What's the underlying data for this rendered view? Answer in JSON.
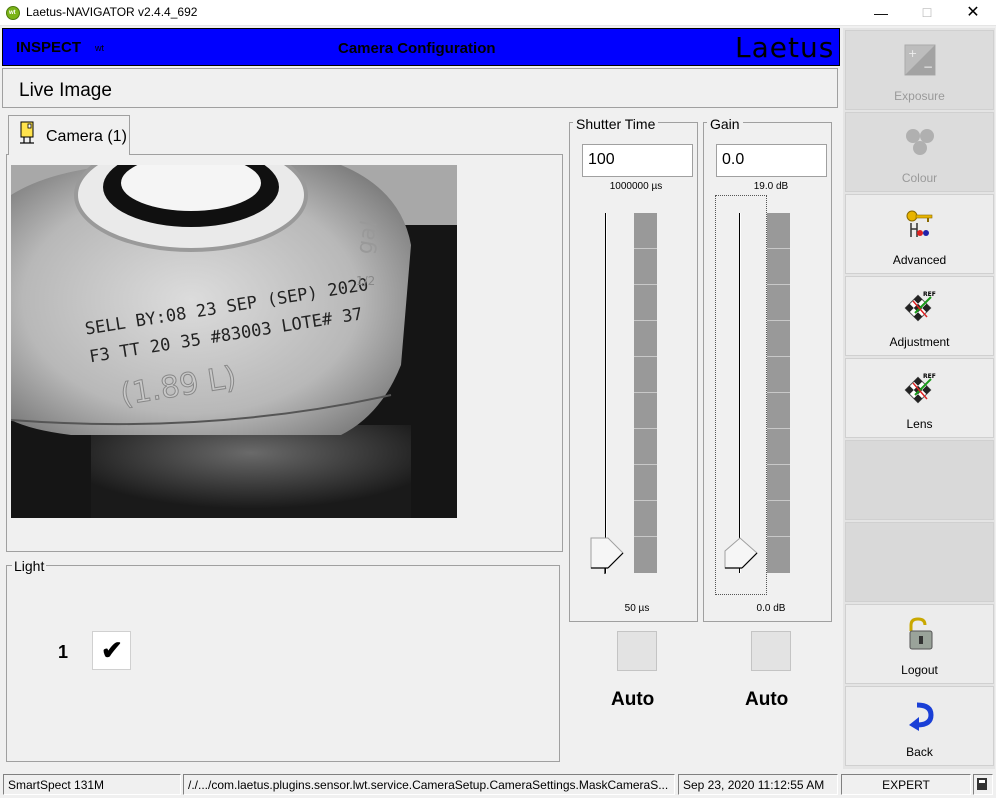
{
  "window": {
    "app_icon_text": "wt",
    "title": "Laetus-NAVIGATOR v2.4.4_692",
    "minimize": "—",
    "maximize": "☐",
    "close": "✕"
  },
  "header": {
    "inspect": "INSPECT",
    "inspect_sub": "wt",
    "title": "Camera Configuration",
    "brand": "Laetus",
    "background_color": "#0000ff"
  },
  "live_image": {
    "label": "Live Image"
  },
  "camera_tab": {
    "label": "Camera (1)"
  },
  "light": {
    "legend": "Light",
    "index": "1",
    "check_mark": "✔",
    "checked": true
  },
  "shutter": {
    "legend": "Shutter Time",
    "value": "100",
    "max_label": "1000000 µs",
    "min_label": "50 µs",
    "auto_label": "Auto",
    "slider_fraction": 0.0
  },
  "gain": {
    "legend": "Gain",
    "value": "0.0",
    "max_label": "19.0 dB",
    "min_label": "0.0 dB",
    "auto_label": "Auto",
    "slider_fraction": 0.0
  },
  "sidebar": {
    "items": [
      {
        "label": "Exposure",
        "icon": "exposure-icon",
        "enabled": false
      },
      {
        "label": "Colour",
        "icon": "colour-icon",
        "enabled": false
      },
      {
        "label": "Advanced",
        "icon": "key-icon",
        "enabled": true
      },
      {
        "label": "Adjustment",
        "icon": "adjustment-icon",
        "enabled": true
      },
      {
        "label": "Lens",
        "icon": "lens-icon",
        "enabled": true
      },
      {
        "label": "",
        "icon": "",
        "enabled": false
      },
      {
        "label": "",
        "icon": "",
        "enabled": false
      },
      {
        "label": "Logout",
        "icon": "padlock-icon",
        "enabled": true
      },
      {
        "label": "Back",
        "icon": "back-arrow-icon",
        "enabled": true
      }
    ],
    "icon_text": {
      "ref": "REF"
    }
  },
  "camera_image": {
    "print_line1": "SELL BY:08 23 SEP (SEP) 2020",
    "print_line2": "F3 TT 20 35 #83003 LOTE# 37",
    "embossed": "(1.89 L)",
    "side_text": "gal",
    "half": "1/2"
  },
  "status": {
    "device": "SmartSpect 131M",
    "path": "/./.../com.laetus.plugins.sensor.lwt.service.CameraSetup.CameraSettings.MaskCameraS...",
    "datetime": "Sep 23, 2020   11:12:55 AM",
    "user_level": "EXPERT"
  }
}
